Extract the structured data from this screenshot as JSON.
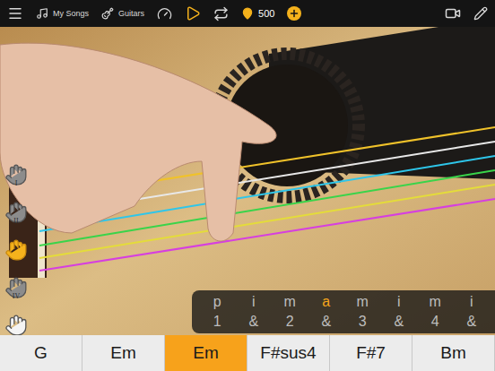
{
  "toolbar": {
    "songs_label": "My Songs",
    "guitars_label": "Guitars",
    "coins": "500"
  },
  "fingers": [
    {
      "label": "I",
      "selected": false,
      "color": "#8c8c8c"
    },
    {
      "label": "II",
      "selected": false,
      "color": "#8c8c8c"
    },
    {
      "label": "",
      "selected": true,
      "color": "#f5b21c"
    },
    {
      "label": "IV",
      "selected": false,
      "color": "#8c8c8c"
    },
    {
      "label": "",
      "selected": false,
      "color": "#f4f4f4"
    }
  ],
  "strings": [
    {
      "color": "#f0c22a"
    },
    {
      "color": "#e8e8e8"
    },
    {
      "color": "#2ec6ea"
    },
    {
      "color": "#39d44a"
    },
    {
      "color": "#e4dc3a"
    },
    {
      "color": "#d63fe0"
    }
  ],
  "pattern": {
    "strokes": [
      {
        "label": "p",
        "selected": false
      },
      {
        "label": "i",
        "selected": false
      },
      {
        "label": "m",
        "selected": false
      },
      {
        "label": "a",
        "selected": true
      },
      {
        "label": "m",
        "selected": false
      },
      {
        "label": "i",
        "selected": false
      },
      {
        "label": "m",
        "selected": false
      },
      {
        "label": "i",
        "selected": false
      }
    ],
    "beats": [
      "1",
      "&",
      "2",
      "&",
      "3",
      "&",
      "4",
      "&"
    ]
  },
  "chords": [
    {
      "label": "G",
      "selected": false
    },
    {
      "label": "Em",
      "selected": false
    },
    {
      "label": "Em",
      "selected": true
    },
    {
      "label": "F#sus4",
      "selected": false
    },
    {
      "label": "F#7",
      "selected": false
    },
    {
      "label": "Bm",
      "selected": false
    }
  ]
}
